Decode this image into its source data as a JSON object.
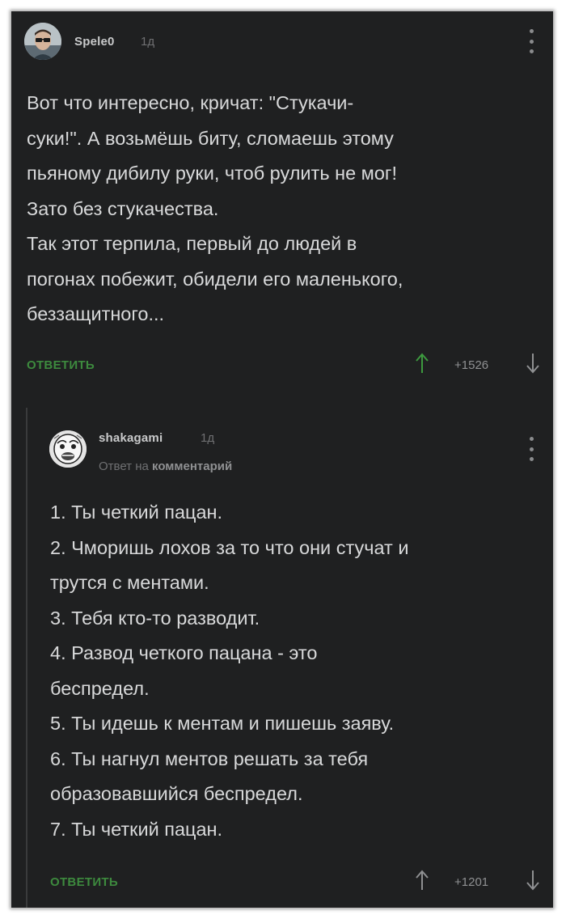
{
  "comment": {
    "username": "Spele0",
    "time": "1д",
    "lines": [
      "Вот что интересно, кричат: \"Стукачи-",
      "суки!\". А возьмёшь биту, сломаешь этому",
      "пьяному дибилу руки, чтоб рулить не мог!",
      "Зато без стукачества.",
      "Так этот терпила, первый до людей в",
      "погонах побежит, обидели его маленького,",
      "беззащитного..."
    ],
    "reply_label": "ОТВЕТИТЬ",
    "score": "+1526",
    "avatar_icon": "user-avatar-glasses"
  },
  "reply": {
    "username": "shakagami",
    "time": "1д",
    "reply_to_prefix": "Ответ на",
    "reply_to_target": "комментарий",
    "lines": [
      "1. Ты четкий пацан.",
      "2. Чморишь лохов за то что они стучат и",
      "трутся с ментами.",
      "3. Тебя кто-то разводит.",
      "4. Развод четкого пацана - это",
      "беспредел.",
      "5. Ты идешь к ментам и пишешь заяву.",
      "6. Ты нагнул ментов решать за тебя",
      "образовавшийся беспредел.",
      "7. Ты четкий пацан."
    ],
    "reply_label": "ОТВЕТИТЬ",
    "score": "+1201",
    "avatar_icon": "user-avatar-meme-face"
  },
  "colors": {
    "background": "#1f2021",
    "text": "#d8d9da",
    "accent_green": "#3d8a3e",
    "muted": "#6f7072"
  }
}
